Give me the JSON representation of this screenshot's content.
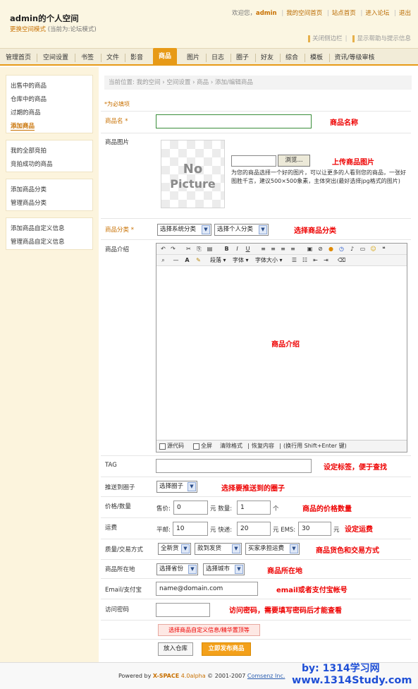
{
  "header": {
    "site_title": "admin的个人空间",
    "mode_link": "更换空间模式",
    "mode_current": "(当前为:论坛模式)",
    "welcome": "欢迎您，",
    "username": "admin",
    "links": [
      "我的空间首页",
      "站点首页",
      "进入论坛",
      "退出"
    ],
    "close_sidebar": "关闭侧边栏",
    "show_help": "显示帮助与提示信息"
  },
  "nav": {
    "items": [
      "管理首页",
      "空间设置",
      "书签",
      "文件",
      "影音",
      "商品",
      "图片",
      "日志",
      "圈子",
      "好友",
      "综合",
      "模板",
      "资讯/等级审核"
    ],
    "active": "商品"
  },
  "sidebar": {
    "group1": [
      "出售中的商品",
      "仓库中的商品",
      "过期的商品",
      "添加商品"
    ],
    "group2": [
      "我的全部竞拍",
      "竞拍成功的商品"
    ],
    "group3": [
      "添加商品分类",
      "管理商品分类"
    ],
    "group4": [
      "添加商品自定义信息",
      "管理商品自定义信息"
    ]
  },
  "breadcrumb": "当前位置: 我的空间 › 空间设置 › 商品 › 添加/编辑商品",
  "form": {
    "required_note": "*为必填项",
    "name_label": "商品名 *",
    "image_label": "商品图片",
    "no_picture_1": "No",
    "no_picture_2": "Picture",
    "browse_label": "浏览...",
    "image_hint": "为您的商品选择一个好的图片，可以让更多的人看到您的商品，一张好图胜千言，建议500×500象素，主体突出(最好选择jpg格式的图片)",
    "category_label": "商品分类 *",
    "system_category": "选择系统分类",
    "personal_category": "选择个人分类",
    "intro_label": "商品介绍",
    "toolbar_paragraph": "段落",
    "toolbar_font": "字体",
    "toolbar_size": "字体大小",
    "editor_source": "源代码",
    "editor_fullscreen": "全屏",
    "editor_clear": "清除格式",
    "editor_restore": "恢复内容",
    "editor_hint": "(换行用 Shift+Enter 键)",
    "tag_label": "TAG",
    "push_label": "推送到圈子",
    "push_select": "选择圈子",
    "price_label": "价格/数量",
    "price_prefix": "售价:",
    "price_value": "0",
    "price_unit": "元 数量:",
    "quantity_value": "1",
    "quantity_unit": "个",
    "shipping_label": "运费",
    "mail_prefix": "平邮:",
    "mail_value": "10",
    "express_prefix": "元 快递:",
    "express_value": "20",
    "ems_prefix": "元 EMS:",
    "ems_value": "30",
    "ems_unit": "元",
    "quality_label": "质量/交易方式",
    "quality_select": "全新货",
    "trade_select": "款到发货",
    "freight_select": "买家承担运费",
    "location_label": "商品所在地",
    "province_select": "选择省份",
    "city_select": "选择城市",
    "email_label": "Email/支付宝",
    "email_value": "name@domain.com",
    "password_label": "访问密码",
    "custom_info_button": "选择商品自定义信息/精华置顶等",
    "store_button": "放入仓库",
    "publish_button": "立即发布商品"
  },
  "annotations": {
    "name": "商品名称",
    "image": "上传商品图片",
    "category": "选择商品分类",
    "intro": "商品介绍",
    "tag": "设定标签，便于查找",
    "push": "选择要推送到的圈子",
    "price": "商品的价格数量",
    "shipping": "设定运费",
    "quality": "商品货色和交易方式",
    "location": "商品所在地",
    "email": "email或者支付宝帐号",
    "password": "访问密码，需要填写密码后才能查看"
  },
  "footer": {
    "powered": "Powered by ",
    "product": "X-SPACE",
    "version": " 4.0alpha",
    "copyright": " © 2001-2007 ",
    "company": "Comsenz Inc.",
    "watermark_1": "by: 1314学习网",
    "watermark_2": "www.1314Study.com"
  }
}
